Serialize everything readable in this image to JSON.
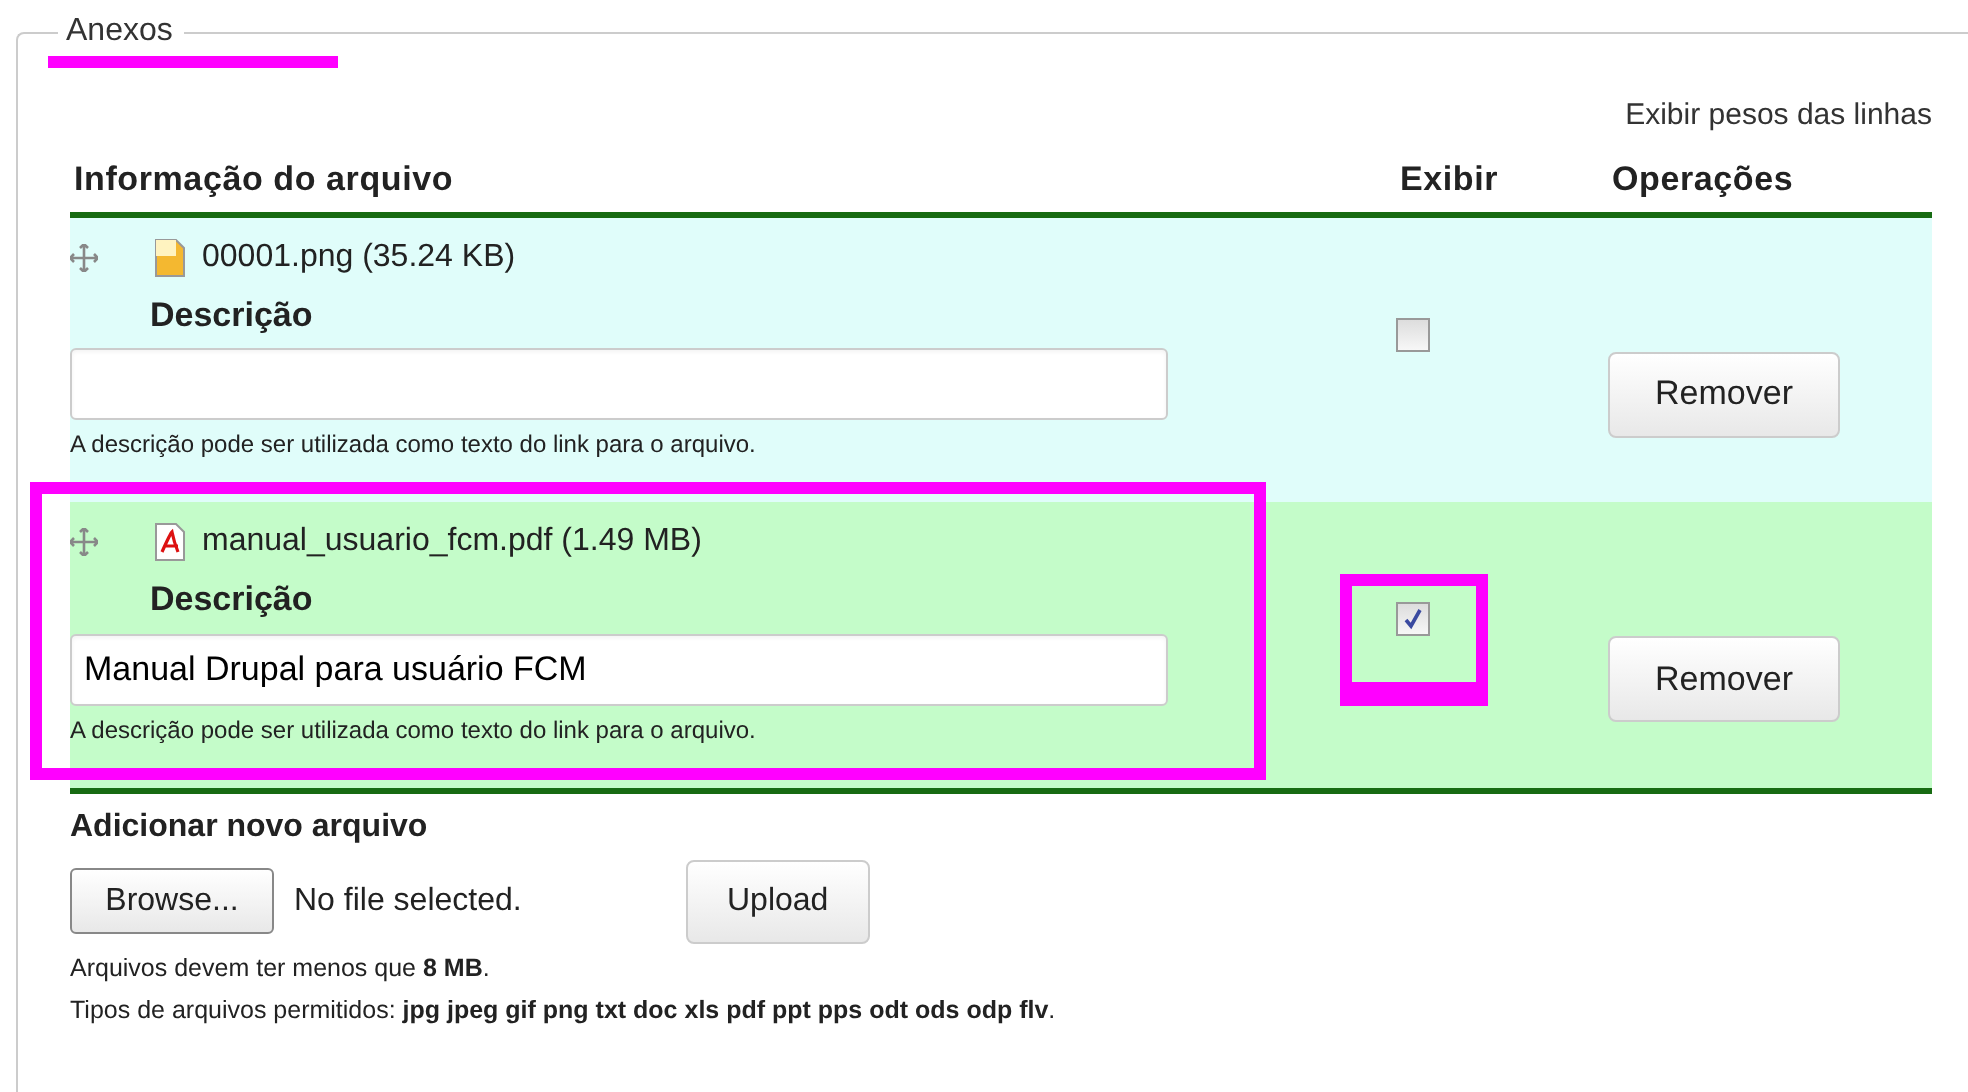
{
  "fieldset": {
    "legend": "Anexos",
    "legend_highlighted": true
  },
  "row_weights_link": "Exibir pesos das linhas",
  "table": {
    "columns": [
      "Informação do arquivo",
      "Exibir",
      "Operações"
    ],
    "rows": [
      {
        "kind": "image",
        "file": "00001.png (35.24 KB)",
        "label": "Descrição",
        "value": "",
        "hint": "A descrição pode ser utilizada como texto do link para o arquivo.",
        "checked": false,
        "button": "Remover",
        "highlighted": false,
        "checkbox_highlighted": false
      },
      {
        "kind": "pdf",
        "file": "manual_usuario_fcm.pdf (1.49 MB)",
        "label": "Descrição",
        "value": "Manual Drupal para usuário FCM",
        "hint": "A descrição pode ser utilizada como texto do link para o arquivo.",
        "checked": true,
        "button": "Remover",
        "highlighted": true,
        "checkbox_highlighted": true
      }
    ]
  },
  "new_file": {
    "label": "Adicionar novo arquivo",
    "browse": "Browse...",
    "status": "No file selected.",
    "upload": "Upload",
    "size_note": "Arquivos devem ter menos que **8 MB**.",
    "types_note": "Tipos de arquivos permitidos: **jpg jpeg gif png txt doc xls pdf ppt pps odt ods odp flv**."
  }
}
